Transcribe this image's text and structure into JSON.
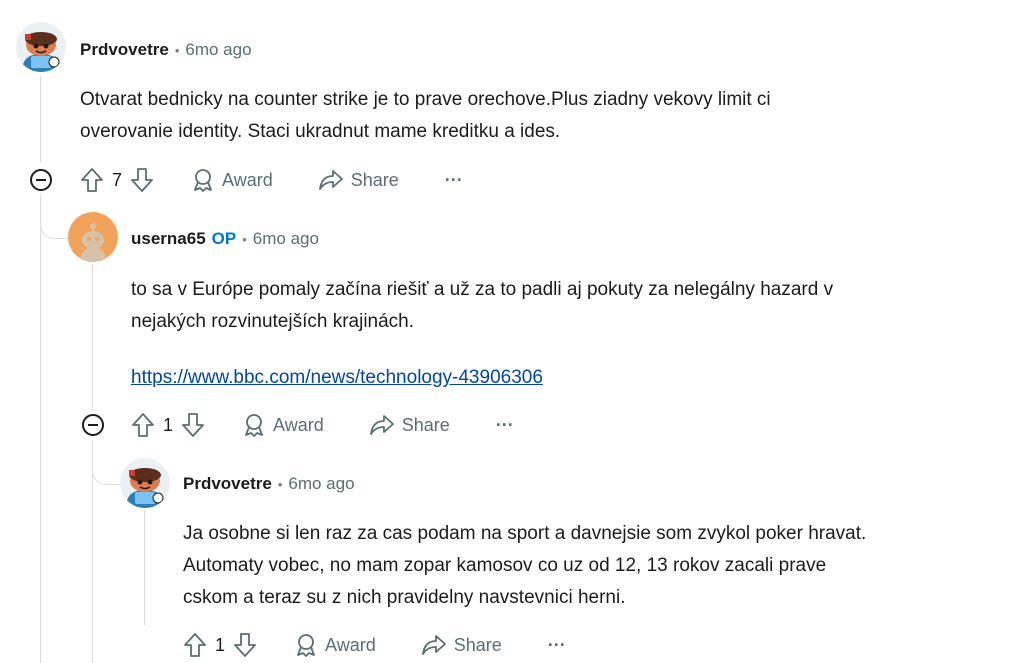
{
  "comments": [
    {
      "author": "Prdvovetre",
      "op": "",
      "separator": "•",
      "time": "6mo ago",
      "body_lines": [
        "Otvarat bednicky na counter strike je to prave orechove.Plus ziadny vekovy limit ci",
        "overovanie identity. Staci ukradnut mame kreditku a ides."
      ],
      "votes": "7",
      "award_label": "Award",
      "share_label": "Share",
      "more_label": "···"
    },
    {
      "author": "userna65",
      "op": "OP",
      "separator": "•",
      "time": "6mo ago",
      "body_lines": [
        "to sa v Európe pomaly začína riešiť a už za to padli aj pokuty za nelegálny hazard v",
        "nejakých rozvinutejších krajinách."
      ],
      "link": "https://www.bbc.com/news/technology-43906306",
      "votes": "1",
      "award_label": "Award",
      "share_label": "Share",
      "more_label": "···"
    },
    {
      "author": "Prdvovetre",
      "op": "",
      "separator": "•",
      "time": "6mo ago",
      "body_lines": [
        "Ja osobne si len raz za cas podam na sport a davnejsie som zvykol poker hravat.",
        "Automaty vobec, no mam zopar kamosov co uz od 12, 13 rokov zacali prave",
        "cskom a teraz su z nich pravidelny navstevnici herni."
      ],
      "votes": "1",
      "award_label": "Award",
      "share_label": "Share",
      "more_label": "···"
    }
  ],
  "icons": {
    "upvote": "upvote-icon",
    "downvote": "downvote-icon",
    "award": "award-icon",
    "share": "share-icon",
    "collapse": "collapse-icon",
    "avatar_1": "snoo-avatar",
    "avatar_2": "default-snoo-avatar"
  },
  "colors": {
    "op_badge": "#0079d3",
    "link": "#0045ac",
    "avatar_orange": "#f3a25a",
    "thread_line": "#dadde0"
  }
}
